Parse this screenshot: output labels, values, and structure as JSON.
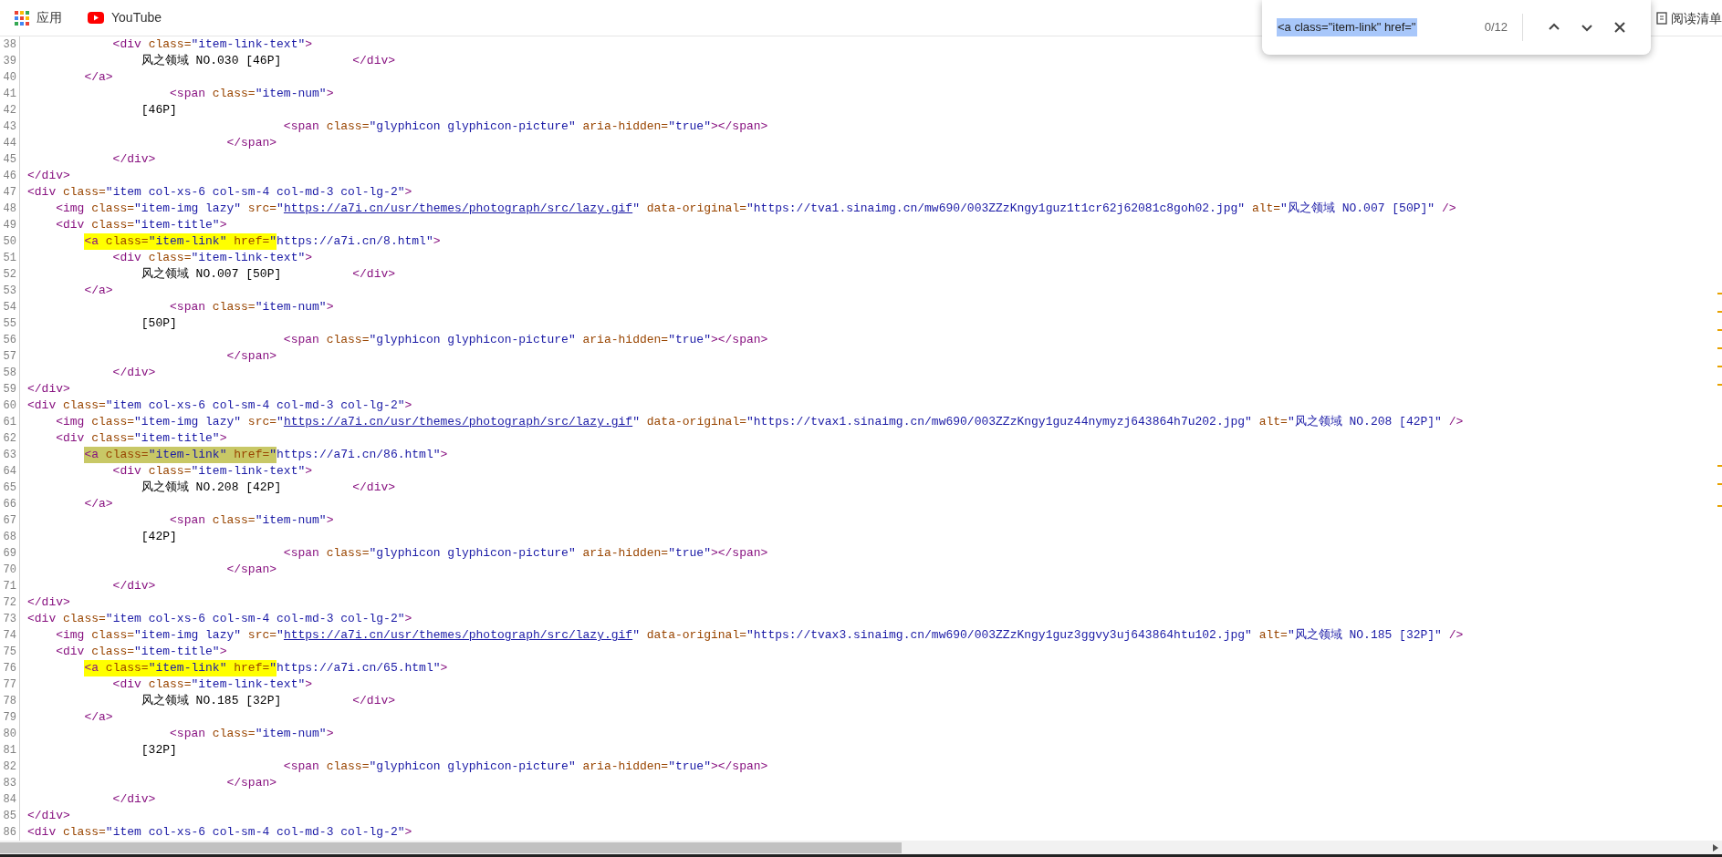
{
  "bookmarks": [
    {
      "kind": "apps",
      "label": "应用"
    },
    {
      "kind": "youtube",
      "label": "YouTube"
    }
  ],
  "reading_list": {
    "label": "阅读清单"
  },
  "find_bar": {
    "query": "<a class=\"item-link\" href=\"",
    "query_selected": true,
    "count": "0/12"
  },
  "code_lines": [
    {
      "number": "38",
      "tokens": [
        {
          "kind": "tag",
          "text": "            <div"
        },
        {
          "kind": "attr",
          "text": " class="
        },
        {
          "kind": "value",
          "text": "\"item-link-text\""
        },
        {
          "kind": "tag",
          "text": ">"
        }
      ]
    },
    {
      "number": "39",
      "tokens": [
        {
          "kind": "text",
          "text": "                风之领域 NO.030 [46P]          "
        },
        {
          "kind": "tag",
          "text": "</div>"
        }
      ]
    },
    {
      "number": "40",
      "tokens": [
        {
          "kind": "tag",
          "text": "        </a>"
        }
      ]
    },
    {
      "number": "41",
      "tokens": [
        {
          "kind": "tag",
          "text": "                    <span"
        },
        {
          "kind": "attr",
          "text": " class="
        },
        {
          "kind": "value",
          "text": "\"item-num\""
        },
        {
          "kind": "tag",
          "text": ">"
        }
      ]
    },
    {
      "number": "42",
      "tokens": [
        {
          "kind": "text",
          "text": "                [46P]"
        }
      ]
    },
    {
      "number": "43",
      "tokens": [
        {
          "kind": "tag",
          "text": "                                    <span"
        },
        {
          "kind": "attr",
          "text": " class="
        },
        {
          "kind": "value",
          "text": "\"glyphicon glyphicon-picture\""
        },
        {
          "kind": "attr",
          "text": " aria-hidden="
        },
        {
          "kind": "value",
          "text": "\"true\""
        },
        {
          "kind": "tag",
          "text": "></span>"
        }
      ]
    },
    {
      "number": "44",
      "tokens": [
        {
          "kind": "tag",
          "text": "                            </span>"
        }
      ]
    },
    {
      "number": "45",
      "tokens": [
        {
          "kind": "tag",
          "text": "            </div>"
        }
      ]
    },
    {
      "number": "46",
      "tokens": [
        {
          "kind": "tag",
          "text": "</div>"
        }
      ]
    },
    {
      "number": "47",
      "tokens": [
        {
          "kind": "tag",
          "text": "<div"
        },
        {
          "kind": "attr",
          "text": " class="
        },
        {
          "kind": "value",
          "text": "\"item col-xs-6 col-sm-4 col-md-3 col-lg-2\""
        },
        {
          "kind": "tag",
          "text": ">"
        }
      ]
    },
    {
      "number": "48",
      "tokens": [
        {
          "kind": "tag",
          "text": "    <img"
        },
        {
          "kind": "attr",
          "text": " class="
        },
        {
          "kind": "value",
          "text": "\"item-img lazy\""
        },
        {
          "kind": "attr",
          "text": " src="
        },
        {
          "kind": "value",
          "text": "\""
        },
        {
          "kind": "link",
          "text": "https://a7i.cn/usr/themes/photograph/src/lazy.gif"
        },
        {
          "kind": "value",
          "text": "\""
        },
        {
          "kind": "attr",
          "text": " data-original="
        },
        {
          "kind": "value",
          "text": "\"https://tva1.sinaimg.cn/mw690/003ZZzKngy1guz1t1cr62j62081c8goh02.jpg\""
        },
        {
          "kind": "attr",
          "text": " alt="
        },
        {
          "kind": "value",
          "text": "\"风之领域 NO.007 [50P]\""
        },
        {
          "kind": "tag",
          "text": " />"
        }
      ]
    },
    {
      "number": "49",
      "tokens": [
        {
          "kind": "tag",
          "text": "    <div"
        },
        {
          "kind": "attr",
          "text": " class="
        },
        {
          "kind": "value",
          "text": "\"item-title\""
        },
        {
          "kind": "tag",
          "text": ">"
        }
      ]
    },
    {
      "number": "50",
      "match": {
        "selected": false,
        "tokens": [
          {
            "kind": "tag",
            "text": "        <a"
          },
          {
            "kind": "attr",
            "text": " class="
          },
          {
            "kind": "value",
            "text": "\"item-link\""
          },
          {
            "kind": "attr",
            "text": " href="
          },
          {
            "kind": "value",
            "text": "\""
          }
        ]
      },
      "tokens": [
        {
          "kind": "value",
          "text": "https://a7i.cn/8.html\""
        },
        {
          "kind": "tag",
          "text": ">"
        }
      ]
    },
    {
      "number": "51",
      "tokens": [
        {
          "kind": "tag",
          "text": "            <div"
        },
        {
          "kind": "attr",
          "text": " class="
        },
        {
          "kind": "value",
          "text": "\"item-link-text\""
        },
        {
          "kind": "tag",
          "text": ">"
        }
      ]
    },
    {
      "number": "52",
      "tokens": [
        {
          "kind": "text",
          "text": "                风之领域 NO.007 [50P]          "
        },
        {
          "kind": "tag",
          "text": "</div>"
        }
      ]
    },
    {
      "number": "53",
      "tokens": [
        {
          "kind": "tag",
          "text": "        </a>"
        }
      ]
    },
    {
      "number": "54",
      "tokens": [
        {
          "kind": "tag",
          "text": "                    <span"
        },
        {
          "kind": "attr",
          "text": " class="
        },
        {
          "kind": "value",
          "text": "\"item-num\""
        },
        {
          "kind": "tag",
          "text": ">"
        }
      ]
    },
    {
      "number": "55",
      "tokens": [
        {
          "kind": "text",
          "text": "                [50P]"
        }
      ]
    },
    {
      "number": "56",
      "tokens": [
        {
          "kind": "tag",
          "text": "                                    <span"
        },
        {
          "kind": "attr",
          "text": " class="
        },
        {
          "kind": "value",
          "text": "\"glyphicon glyphicon-picture\""
        },
        {
          "kind": "attr",
          "text": " aria-hidden="
        },
        {
          "kind": "value",
          "text": "\"true\""
        },
        {
          "kind": "tag",
          "text": "></span>"
        }
      ]
    },
    {
      "number": "57",
      "tokens": [
        {
          "kind": "tag",
          "text": "                            </span>"
        }
      ]
    },
    {
      "number": "58",
      "tokens": [
        {
          "kind": "tag",
          "text": "            </div>"
        }
      ]
    },
    {
      "number": "59",
      "tokens": [
        {
          "kind": "tag",
          "text": "</div>"
        }
      ]
    },
    {
      "number": "60",
      "tokens": [
        {
          "kind": "tag",
          "text": "<div"
        },
        {
          "kind": "attr",
          "text": " class="
        },
        {
          "kind": "value",
          "text": "\"item col-xs-6 col-sm-4 col-md-3 col-lg-2\""
        },
        {
          "kind": "tag",
          "text": ">"
        }
      ]
    },
    {
      "number": "61",
      "tokens": [
        {
          "kind": "tag",
          "text": "    <img"
        },
        {
          "kind": "attr",
          "text": " class="
        },
        {
          "kind": "value",
          "text": "\"item-img lazy\""
        },
        {
          "kind": "attr",
          "text": " src="
        },
        {
          "kind": "value",
          "text": "\""
        },
        {
          "kind": "link",
          "text": "https://a7i.cn/usr/themes/photograph/src/lazy.gif"
        },
        {
          "kind": "value",
          "text": "\""
        },
        {
          "kind": "attr",
          "text": " data-original="
        },
        {
          "kind": "value",
          "text": "\"https://tvax1.sinaimg.cn/mw690/003ZZzKngy1guz44nymyzj643864h7u202.jpg\""
        },
        {
          "kind": "attr",
          "text": " alt="
        },
        {
          "kind": "value",
          "text": "\"风之领域 NO.208 [42P]\""
        },
        {
          "kind": "tag",
          "text": " />"
        }
      ]
    },
    {
      "number": "62",
      "tokens": [
        {
          "kind": "tag",
          "text": "    <div"
        },
        {
          "kind": "attr",
          "text": " class="
        },
        {
          "kind": "value",
          "text": "\"item-title\""
        },
        {
          "kind": "tag",
          "text": ">"
        }
      ]
    },
    {
      "number": "63",
      "match": {
        "selected": true,
        "tokens": [
          {
            "kind": "tag",
            "text": "        <a"
          },
          {
            "kind": "attr",
            "text": " class="
          },
          {
            "kind": "value",
            "text": "\"item-link\""
          },
          {
            "kind": "attr",
            "text": " href="
          },
          {
            "kind": "value",
            "text": "\""
          }
        ]
      },
      "tokens": [
        {
          "kind": "value",
          "text": "https://a7i.cn/86.html\""
        },
        {
          "kind": "tag",
          "text": ">"
        }
      ]
    },
    {
      "number": "64",
      "tokens": [
        {
          "kind": "tag",
          "text": "            <div"
        },
        {
          "kind": "attr",
          "text": " class="
        },
        {
          "kind": "value",
          "text": "\"item-link-text\""
        },
        {
          "kind": "tag",
          "text": ">"
        }
      ]
    },
    {
      "number": "65",
      "tokens": [
        {
          "kind": "text",
          "text": "                风之领域 NO.208 [42P]          "
        },
        {
          "kind": "tag",
          "text": "</div>"
        }
      ]
    },
    {
      "number": "66",
      "tokens": [
        {
          "kind": "tag",
          "text": "        </a>"
        }
      ]
    },
    {
      "number": "67",
      "tokens": [
        {
          "kind": "tag",
          "text": "                    <span"
        },
        {
          "kind": "attr",
          "text": " class="
        },
        {
          "kind": "value",
          "text": "\"item-num\""
        },
        {
          "kind": "tag",
          "text": ">"
        }
      ]
    },
    {
      "number": "68",
      "tokens": [
        {
          "kind": "text",
          "text": "                [42P]"
        }
      ]
    },
    {
      "number": "69",
      "tokens": [
        {
          "kind": "tag",
          "text": "                                    <span"
        },
        {
          "kind": "attr",
          "text": " class="
        },
        {
          "kind": "value",
          "text": "\"glyphicon glyphicon-picture\""
        },
        {
          "kind": "attr",
          "text": " aria-hidden="
        },
        {
          "kind": "value",
          "text": "\"true\""
        },
        {
          "kind": "tag",
          "text": "></span>"
        }
      ]
    },
    {
      "number": "70",
      "tokens": [
        {
          "kind": "tag",
          "text": "                            </span>"
        }
      ]
    },
    {
      "number": "71",
      "tokens": [
        {
          "kind": "tag",
          "text": "            </div>"
        }
      ]
    },
    {
      "number": "72",
      "tokens": [
        {
          "kind": "tag",
          "text": "</div>"
        }
      ]
    },
    {
      "number": "73",
      "tokens": [
        {
          "kind": "tag",
          "text": "<div"
        },
        {
          "kind": "attr",
          "text": " class="
        },
        {
          "kind": "value",
          "text": "\"item col-xs-6 col-sm-4 col-md-3 col-lg-2\""
        },
        {
          "kind": "tag",
          "text": ">"
        }
      ]
    },
    {
      "number": "74",
      "tokens": [
        {
          "kind": "tag",
          "text": "    <img"
        },
        {
          "kind": "attr",
          "text": " class="
        },
        {
          "kind": "value",
          "text": "\"item-img lazy\""
        },
        {
          "kind": "attr",
          "text": " src="
        },
        {
          "kind": "value",
          "text": "\""
        },
        {
          "kind": "link",
          "text": "https://a7i.cn/usr/themes/photograph/src/lazy.gif"
        },
        {
          "kind": "value",
          "text": "\""
        },
        {
          "kind": "attr",
          "text": " data-original="
        },
        {
          "kind": "value",
          "text": "\"https://tvax3.sinaimg.cn/mw690/003ZZzKngy1guz3ggvy3uj643864htu102.jpg\""
        },
        {
          "kind": "attr",
          "text": " alt="
        },
        {
          "kind": "value",
          "text": "\"风之领域 NO.185 [32P]\""
        },
        {
          "kind": "tag",
          "text": " />"
        }
      ]
    },
    {
      "number": "75",
      "tokens": [
        {
          "kind": "tag",
          "text": "    <div"
        },
        {
          "kind": "attr",
          "text": " class="
        },
        {
          "kind": "value",
          "text": "\"item-title\""
        },
        {
          "kind": "tag",
          "text": ">"
        }
      ]
    },
    {
      "number": "76",
      "match": {
        "selected": false,
        "tokens": [
          {
            "kind": "tag",
            "text": "        <a"
          },
          {
            "kind": "attr",
            "text": " class="
          },
          {
            "kind": "value",
            "text": "\"item-link\""
          },
          {
            "kind": "attr",
            "text": " href="
          },
          {
            "kind": "value",
            "text": "\""
          }
        ]
      },
      "tokens": [
        {
          "kind": "value",
          "text": "https://a7i.cn/65.html\""
        },
        {
          "kind": "tag",
          "text": ">"
        }
      ]
    },
    {
      "number": "77",
      "tokens": [
        {
          "kind": "tag",
          "text": "            <div"
        },
        {
          "kind": "attr",
          "text": " class="
        },
        {
          "kind": "value",
          "text": "\"item-link-text\""
        },
        {
          "kind": "tag",
          "text": ">"
        }
      ]
    },
    {
      "number": "78",
      "tokens": [
        {
          "kind": "text",
          "text": "                风之领域 NO.185 [32P]          "
        },
        {
          "kind": "tag",
          "text": "</div>"
        }
      ]
    },
    {
      "number": "79",
      "tokens": [
        {
          "kind": "tag",
          "text": "        </a>"
        }
      ]
    },
    {
      "number": "80",
      "tokens": [
        {
          "kind": "tag",
          "text": "                    <span"
        },
        {
          "kind": "attr",
          "text": " class="
        },
        {
          "kind": "value",
          "text": "\"item-num\""
        },
        {
          "kind": "tag",
          "text": ">"
        }
      ]
    },
    {
      "number": "81",
      "tokens": [
        {
          "kind": "text",
          "text": "                [32P]"
        }
      ]
    },
    {
      "number": "82",
      "tokens": [
        {
          "kind": "tag",
          "text": "                                    <span"
        },
        {
          "kind": "attr",
          "text": " class="
        },
        {
          "kind": "value",
          "text": "\"glyphicon glyphicon-picture\""
        },
        {
          "kind": "attr",
          "text": " aria-hidden="
        },
        {
          "kind": "value",
          "text": "\"true\""
        },
        {
          "kind": "tag",
          "text": "></span>"
        }
      ]
    },
    {
      "number": "83",
      "tokens": [
        {
          "kind": "tag",
          "text": "                            </span>"
        }
      ]
    },
    {
      "number": "84",
      "tokens": [
        {
          "kind": "tag",
          "text": "            </div>"
        }
      ]
    },
    {
      "number": "85",
      "tokens": [
        {
          "kind": "tag",
          "text": "</div>"
        }
      ]
    },
    {
      "number": "86",
      "tokens": [
        {
          "kind": "tag",
          "text": "<div"
        },
        {
          "kind": "attr",
          "text": " class="
        },
        {
          "kind": "value",
          "text": "\"item col-xs-6 col-sm-4 col-md-3 col-lg-2\""
        },
        {
          "kind": "tag",
          "text": ">"
        }
      ]
    }
  ]
}
